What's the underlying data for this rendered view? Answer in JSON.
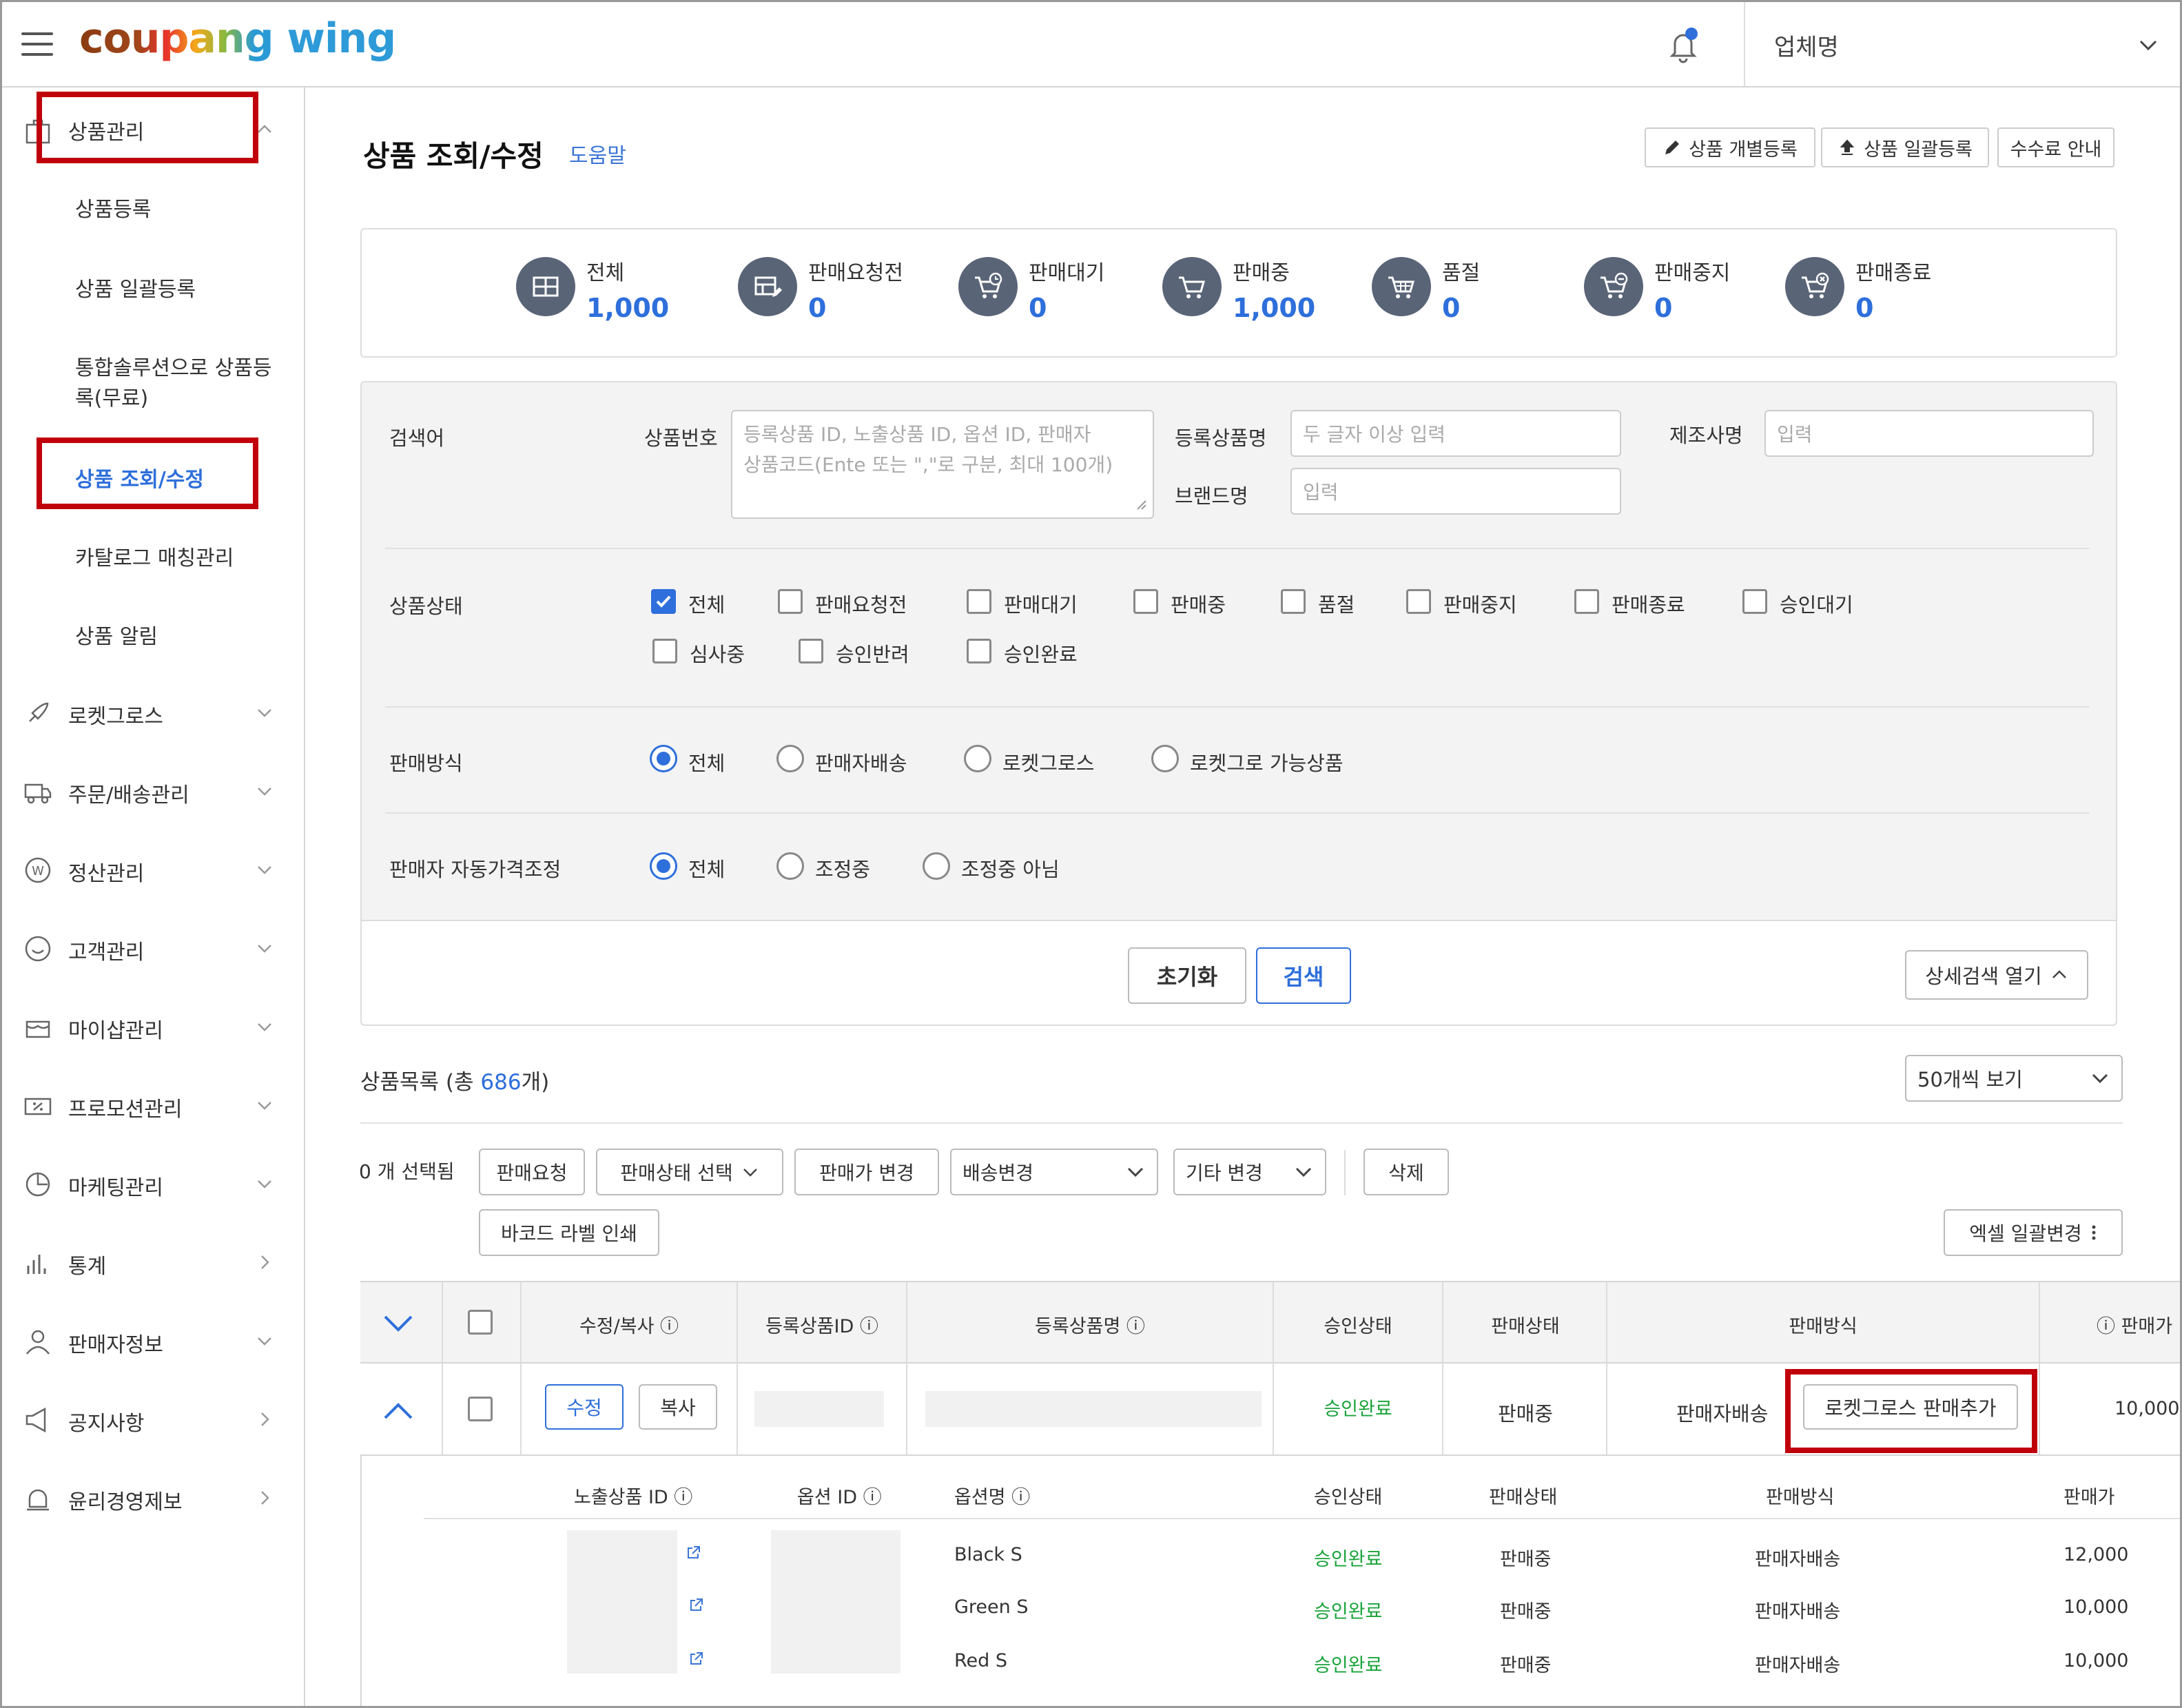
{
  "header": {
    "logo_main": "coupang",
    "logo_sub": "wing",
    "company": "업체명"
  },
  "sidebar": {
    "product_mgmt": "상품관리",
    "subitems": [
      "상품등록",
      "상품 일괄등록",
      "통합솔루션으로 상품등",
      "록(무료)",
      "상품 조회/수정",
      "카탈로그 매칭관리",
      "상품 알림"
    ],
    "menus": [
      "로켓그로스",
      "주문/배송관리",
      "정산관리",
      "고객관리",
      "마이샵관리",
      "프로모션관리",
      "마케팅관리",
      "통계",
      "판매자정보",
      "공지사항",
      "윤리경영제보"
    ]
  },
  "page": {
    "title": "상품 조회/수정",
    "help": "도움말"
  },
  "top_buttons": [
    "상품 개별등록",
    "상품 일괄등록",
    "수수료 안내"
  ],
  "stats": [
    {
      "label": "전체",
      "value": "1,000"
    },
    {
      "label": "판매요청전",
      "value": "0"
    },
    {
      "label": "판매대기",
      "value": "0"
    },
    {
      "label": "판매중",
      "value": "1,000"
    },
    {
      "label": "품절",
      "value": "0"
    },
    {
      "label": "판매중지",
      "value": "0"
    },
    {
      "label": "판매종료",
      "value": "0"
    }
  ],
  "search": {
    "keyword_label": "검색어",
    "product_no_label": "상품번호",
    "product_no_placeholder_1": "등록상품 ID,  노출상품 ID, 옵션 ID, 판매자",
    "product_no_placeholder_2": "상품코드(Ente 또는 \",\"로 구분, 최대 100개)",
    "reg_name_label": "등록상품명",
    "reg_name_placeholder": "두 글자 이상 입력",
    "brand_label": "브랜드명",
    "brand_placeholder": "입력",
    "maker_label": "제조사명",
    "maker_placeholder": "입력",
    "status_label": "상품상태",
    "status_options": [
      "전체",
      "판매요청전",
      "판매대기",
      "판매중",
      "품절",
      "판매중지",
      "판매종료",
      "승인대기",
      "심사중",
      "승인반려",
      "승인완료"
    ],
    "method_label": "판매방식",
    "method_options": [
      "전체",
      "판매자배송",
      "로켓그로스",
      "로켓그로 가능상품"
    ],
    "auto_label": "판매자 자동가격조정",
    "auto_options": [
      "전체",
      "조정중",
      "조정중 아님"
    ],
    "reset": "초기화",
    "search_btn": "검색",
    "detail": "상세검색 열기"
  },
  "list": {
    "title_prefix": "상품목록 (총 ",
    "count": "686",
    "title_suffix": "개)",
    "page_size": "50개씩 보기",
    "selected": "0 개 선택됨",
    "actions": [
      "판매요청",
      "판매상태 선택",
      "판매가 변경",
      "배송변경",
      "기타 변경",
      "삭제",
      "바코드 라벨 인쇄"
    ],
    "excel": "엑셀 일괄변경"
  },
  "table": {
    "headers": [
      "수정/복사",
      "등록상품ID",
      "등록상품명",
      "승인상태",
      "판매상태",
      "판매방식",
      "판매가"
    ],
    "row": {
      "edit": "수정",
      "copy": "복사",
      "approval": "승인완료",
      "status": "판매중",
      "method": "판매자배송",
      "rocket_btn": "로켓그로스 판매추가",
      "price": "10,000~"
    },
    "sub_headers": [
      "노출상품 ID",
      "옵션 ID",
      "옵션명",
      "승인상태",
      "판매상태",
      "판매방식",
      "판매가"
    ],
    "sub_rows": [
      {
        "option": "Black S",
        "approval": "승인완료",
        "status": "판매중",
        "method": "판매자배송",
        "price": "12,000"
      },
      {
        "option": "Green S",
        "approval": "승인완료",
        "status": "판매중",
        "method": "판매자배송",
        "price": "10,000"
      },
      {
        "option": "Red S",
        "approval": "승인완료",
        "status": "판매중",
        "method": "판매자배송",
        "price": "10,000"
      }
    ]
  },
  "colors": {
    "accent": "#2e6fdb",
    "highlight": "#c0000b",
    "approved": "#19a33a"
  }
}
